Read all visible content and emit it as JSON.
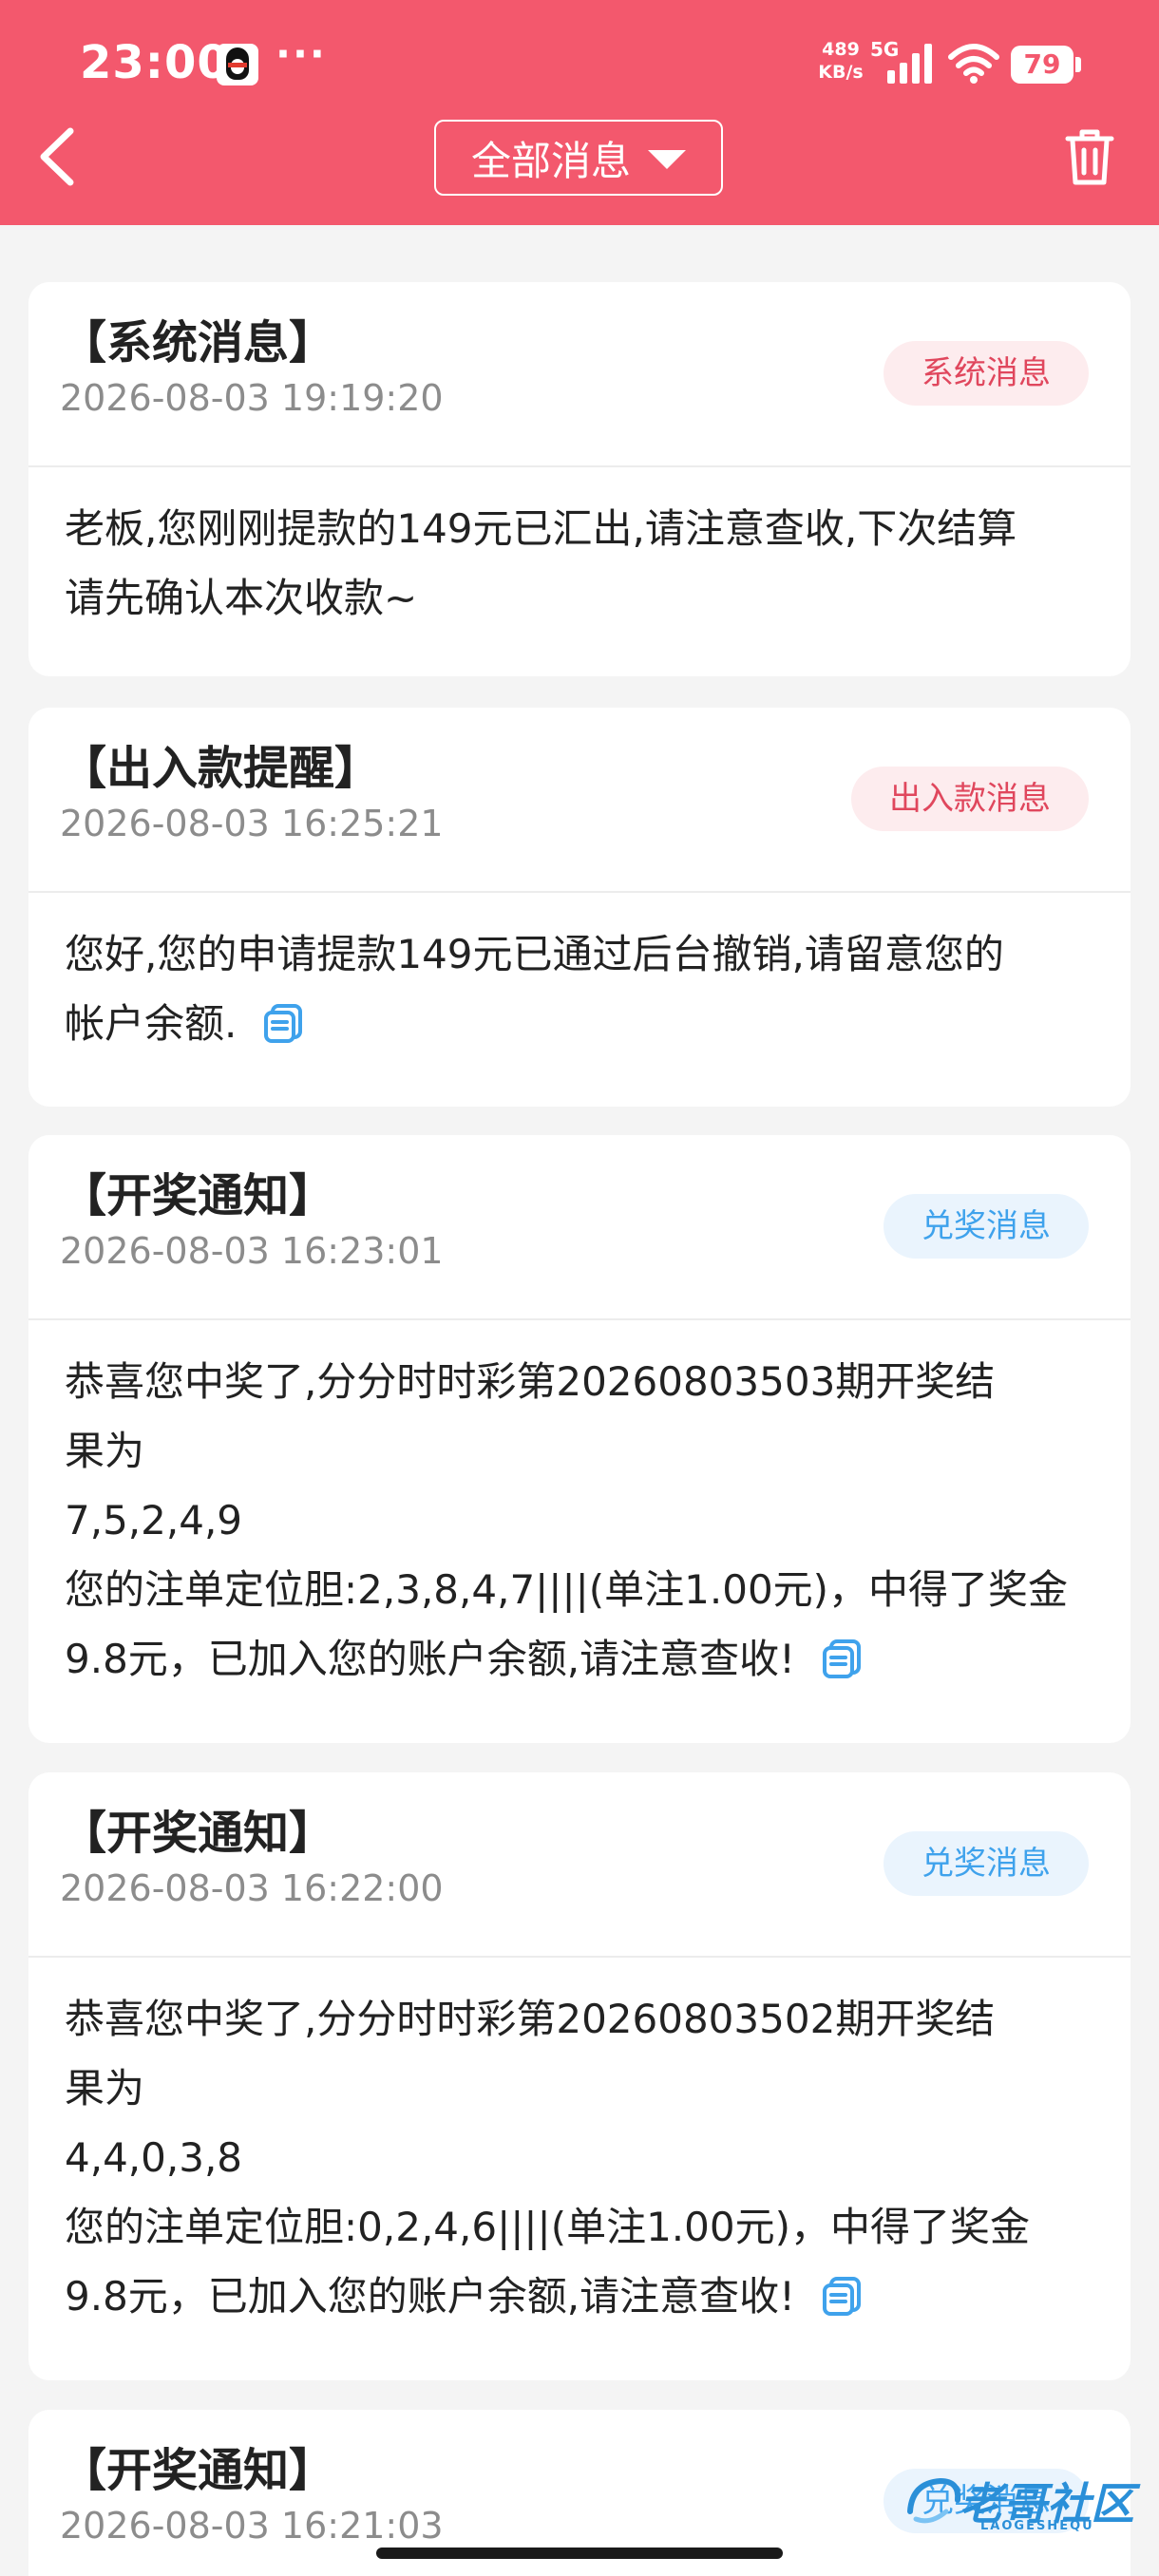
{
  "status_bar": {
    "time": "23:00",
    "more": "···",
    "net_speed_value": "489",
    "net_speed_unit": "KB/s",
    "net_type": "5G",
    "battery": "79"
  },
  "header": {
    "filter_label": "全部消息",
    "accent_color": "#f3586d"
  },
  "messages": [
    {
      "title": "【系统消息】",
      "time": "2026-08-03 19:19:20",
      "badge": "系统消息",
      "lines": [
        "老板,您刚刚提款的149元已汇出,请注意查收,下次结算",
        "请先确认本次收款~"
      ]
    },
    {
      "title": "【出入款提醒】",
      "time": "2026-08-03 16:25:21",
      "badge": "出入款消息",
      "lines": [
        "您好,您的申请提款149元已通过后台撤销,请留意您的",
        "帐户余额."
      ]
    },
    {
      "title": "【开奖通知】",
      "time": "2026-08-03 16:23:01",
      "badge": "兑奖消息",
      "lines": [
        "恭喜您中奖了,分分时时彩第20260803503期开奖结",
        "果为",
        "7,5,2,4,9",
        "您的注单定位胆:2,3,8,4,7||||(单注1.00元)，中得了奖金",
        "9.8元，已加入您的账户余额,请注意查收!"
      ]
    },
    {
      "title": "【开奖通知】",
      "time": "2026-08-03 16:22:00",
      "badge": "兑奖消息",
      "lines": [
        "恭喜您中奖了,分分时时彩第20260803502期开奖结",
        "果为",
        "4,4,0,3,8",
        "您的注单定位胆:0,2,4,6||||(单注1.00元)，中得了奖金",
        "9.8元，已加入您的账户余额,请注意查收!"
      ]
    },
    {
      "title": "【开奖通知】",
      "time": "2026-08-03 16:21:03",
      "badge": "兑奖消息"
    }
  ],
  "watermark": {
    "text": "老哥社区",
    "sub": "LAOGESHEQU"
  }
}
